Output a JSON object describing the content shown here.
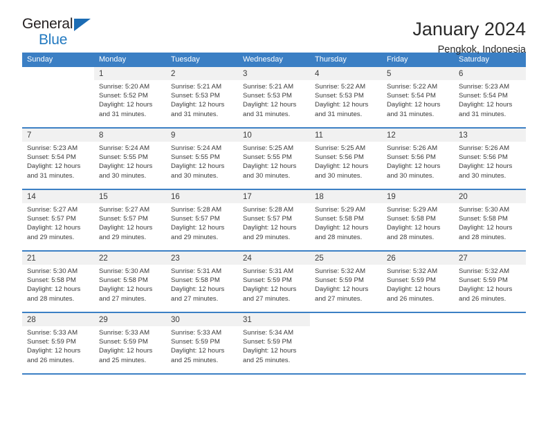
{
  "brand": {
    "name_part1": "General",
    "name_part2": "Blue",
    "triangle_icon": "triangle-logo-icon",
    "accent_color": "#2279c0"
  },
  "header": {
    "title": "January 2024",
    "subtitle": "Pengkok, Indonesia"
  },
  "theme": {
    "header_blue": "#3b7fc4",
    "daynum_gray": "#f1f1f1",
    "text_color": "#3a3a3a"
  },
  "calendar": {
    "weekday_headers": [
      "Sunday",
      "Monday",
      "Tuesday",
      "Wednesday",
      "Thursday",
      "Friday",
      "Saturday"
    ],
    "weeks": [
      [
        {
          "day": "",
          "lines": []
        },
        {
          "day": "1",
          "lines": [
            "Sunrise: 5:20 AM",
            "Sunset: 5:52 PM",
            "Daylight: 12 hours",
            "and 31 minutes."
          ]
        },
        {
          "day": "2",
          "lines": [
            "Sunrise: 5:21 AM",
            "Sunset: 5:53 PM",
            "Daylight: 12 hours",
            "and 31 minutes."
          ]
        },
        {
          "day": "3",
          "lines": [
            "Sunrise: 5:21 AM",
            "Sunset: 5:53 PM",
            "Daylight: 12 hours",
            "and 31 minutes."
          ]
        },
        {
          "day": "4",
          "lines": [
            "Sunrise: 5:22 AM",
            "Sunset: 5:53 PM",
            "Daylight: 12 hours",
            "and 31 minutes."
          ]
        },
        {
          "day": "5",
          "lines": [
            "Sunrise: 5:22 AM",
            "Sunset: 5:54 PM",
            "Daylight: 12 hours",
            "and 31 minutes."
          ]
        },
        {
          "day": "6",
          "lines": [
            "Sunrise: 5:23 AM",
            "Sunset: 5:54 PM",
            "Daylight: 12 hours",
            "and 31 minutes."
          ]
        }
      ],
      [
        {
          "day": "7",
          "lines": [
            "Sunrise: 5:23 AM",
            "Sunset: 5:54 PM",
            "Daylight: 12 hours",
            "and 31 minutes."
          ]
        },
        {
          "day": "8",
          "lines": [
            "Sunrise: 5:24 AM",
            "Sunset: 5:55 PM",
            "Daylight: 12 hours",
            "and 30 minutes."
          ]
        },
        {
          "day": "9",
          "lines": [
            "Sunrise: 5:24 AM",
            "Sunset: 5:55 PM",
            "Daylight: 12 hours",
            "and 30 minutes."
          ]
        },
        {
          "day": "10",
          "lines": [
            "Sunrise: 5:25 AM",
            "Sunset: 5:55 PM",
            "Daylight: 12 hours",
            "and 30 minutes."
          ]
        },
        {
          "day": "11",
          "lines": [
            "Sunrise: 5:25 AM",
            "Sunset: 5:56 PM",
            "Daylight: 12 hours",
            "and 30 minutes."
          ]
        },
        {
          "day": "12",
          "lines": [
            "Sunrise: 5:26 AM",
            "Sunset: 5:56 PM",
            "Daylight: 12 hours",
            "and 30 minutes."
          ]
        },
        {
          "day": "13",
          "lines": [
            "Sunrise: 5:26 AM",
            "Sunset: 5:56 PM",
            "Daylight: 12 hours",
            "and 30 minutes."
          ]
        }
      ],
      [
        {
          "day": "14",
          "lines": [
            "Sunrise: 5:27 AM",
            "Sunset: 5:57 PM",
            "Daylight: 12 hours",
            "and 29 minutes."
          ]
        },
        {
          "day": "15",
          "lines": [
            "Sunrise: 5:27 AM",
            "Sunset: 5:57 PM",
            "Daylight: 12 hours",
            "and 29 minutes."
          ]
        },
        {
          "day": "16",
          "lines": [
            "Sunrise: 5:28 AM",
            "Sunset: 5:57 PM",
            "Daylight: 12 hours",
            "and 29 minutes."
          ]
        },
        {
          "day": "17",
          "lines": [
            "Sunrise: 5:28 AM",
            "Sunset: 5:57 PM",
            "Daylight: 12 hours",
            "and 29 minutes."
          ]
        },
        {
          "day": "18",
          "lines": [
            "Sunrise: 5:29 AM",
            "Sunset: 5:58 PM",
            "Daylight: 12 hours",
            "and 28 minutes."
          ]
        },
        {
          "day": "19",
          "lines": [
            "Sunrise: 5:29 AM",
            "Sunset: 5:58 PM",
            "Daylight: 12 hours",
            "and 28 minutes."
          ]
        },
        {
          "day": "20",
          "lines": [
            "Sunrise: 5:30 AM",
            "Sunset: 5:58 PM",
            "Daylight: 12 hours",
            "and 28 minutes."
          ]
        }
      ],
      [
        {
          "day": "21",
          "lines": [
            "Sunrise: 5:30 AM",
            "Sunset: 5:58 PM",
            "Daylight: 12 hours",
            "and 28 minutes."
          ]
        },
        {
          "day": "22",
          "lines": [
            "Sunrise: 5:30 AM",
            "Sunset: 5:58 PM",
            "Daylight: 12 hours",
            "and 27 minutes."
          ]
        },
        {
          "day": "23",
          "lines": [
            "Sunrise: 5:31 AM",
            "Sunset: 5:58 PM",
            "Daylight: 12 hours",
            "and 27 minutes."
          ]
        },
        {
          "day": "24",
          "lines": [
            "Sunrise: 5:31 AM",
            "Sunset: 5:59 PM",
            "Daylight: 12 hours",
            "and 27 minutes."
          ]
        },
        {
          "day": "25",
          "lines": [
            "Sunrise: 5:32 AM",
            "Sunset: 5:59 PM",
            "Daylight: 12 hours",
            "and 27 minutes."
          ]
        },
        {
          "day": "26",
          "lines": [
            "Sunrise: 5:32 AM",
            "Sunset: 5:59 PM",
            "Daylight: 12 hours",
            "and 26 minutes."
          ]
        },
        {
          "day": "27",
          "lines": [
            "Sunrise: 5:32 AM",
            "Sunset: 5:59 PM",
            "Daylight: 12 hours",
            "and 26 minutes."
          ]
        }
      ],
      [
        {
          "day": "28",
          "lines": [
            "Sunrise: 5:33 AM",
            "Sunset: 5:59 PM",
            "Daylight: 12 hours",
            "and 26 minutes."
          ]
        },
        {
          "day": "29",
          "lines": [
            "Sunrise: 5:33 AM",
            "Sunset: 5:59 PM",
            "Daylight: 12 hours",
            "and 25 minutes."
          ]
        },
        {
          "day": "30",
          "lines": [
            "Sunrise: 5:33 AM",
            "Sunset: 5:59 PM",
            "Daylight: 12 hours",
            "and 25 minutes."
          ]
        },
        {
          "day": "31",
          "lines": [
            "Sunrise: 5:34 AM",
            "Sunset: 5:59 PM",
            "Daylight: 12 hours",
            "and 25 minutes."
          ]
        },
        {
          "day": "",
          "lines": []
        },
        {
          "day": "",
          "lines": []
        },
        {
          "day": "",
          "lines": []
        }
      ]
    ]
  }
}
